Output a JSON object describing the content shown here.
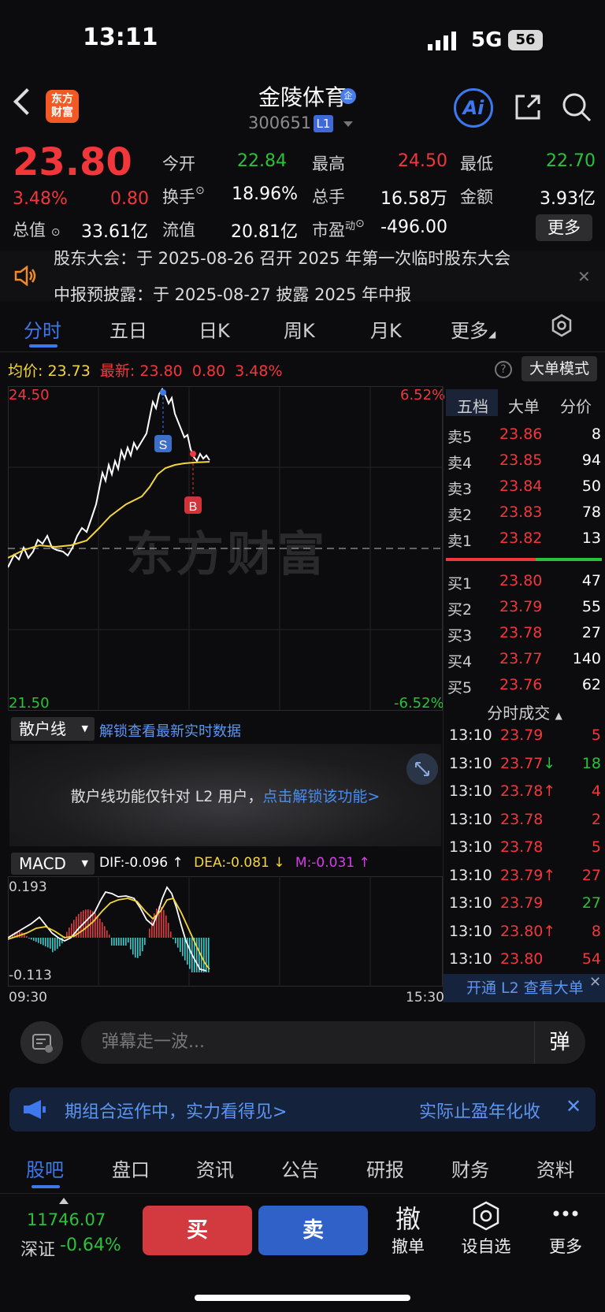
{
  "status_bar": {
    "time": "13:11",
    "network": "5G",
    "battery": "56"
  },
  "header": {
    "logo_text": "东方\n财富",
    "stock_name": "金陵体育",
    "name_badge": "企",
    "stock_code": "300651",
    "level": "L1",
    "ai_label": "Ai"
  },
  "quote": {
    "price": "23.80",
    "change_pct": "3.48%",
    "change_val": "0.80",
    "open_label": "今开",
    "open": "22.84",
    "high_label": "最高",
    "high": "24.50",
    "low_label": "最低",
    "low": "22.70",
    "turnover_label": "换手",
    "turnover": "18.96%",
    "volume_label": "总手",
    "volume": "16.58万",
    "amount_label": "金额",
    "amount": "3.93亿",
    "total_cap_label": "总值",
    "total_cap": "33.61亿",
    "float_cap_label": "流值",
    "float_cap": "20.81亿",
    "pe_label": "市盈",
    "pe_sup": "动",
    "pe": "-496.00",
    "more_label": "更多"
  },
  "notice": {
    "line1": "股东大会：于 2025-08-26 召开 2025 年第一次临时股东大会",
    "line2": "中报预披露：于 2025-08-27 披露 2025 年中报"
  },
  "chart_tabs": [
    "分时",
    "五日",
    "日K",
    "周K",
    "月K",
    "更多"
  ],
  "info_line": {
    "avg_label": "均价:",
    "avg": "23.73",
    "latest_label": "最新:",
    "latest": "23.80",
    "change": "0.80",
    "pct": "3.48%",
    "mode_button": "大单模式"
  },
  "chart_labels": {
    "y_top": "24.50",
    "y_bottom": "21.50",
    "pct_top": "6.52%",
    "pct_bottom": "-6.52%",
    "watermark": "东方财富",
    "sell_marker": "S",
    "buy_marker": "B"
  },
  "colors": {
    "up": "#f2373c",
    "down": "#29c23a",
    "avg": "#f4d63c",
    "accent": "#3d79ec"
  },
  "side_tabs": [
    "五档",
    "大单",
    "分价"
  ],
  "order_book": {
    "asks": [
      {
        "label": "卖5",
        "price": "23.86",
        "vol": "8"
      },
      {
        "label": "卖4",
        "price": "23.85",
        "vol": "94"
      },
      {
        "label": "卖3",
        "price": "23.84",
        "vol": "50"
      },
      {
        "label": "卖2",
        "price": "23.83",
        "vol": "78"
      },
      {
        "label": "卖1",
        "price": "23.82",
        "vol": "13"
      }
    ],
    "bids": [
      {
        "label": "买1",
        "price": "23.80",
        "vol": "47"
      },
      {
        "label": "买2",
        "price": "23.79",
        "vol": "55"
      },
      {
        "label": "买3",
        "price": "23.78",
        "vol": "27"
      },
      {
        "label": "买4",
        "price": "23.77",
        "vol": "140"
      },
      {
        "label": "买5",
        "price": "23.76",
        "vol": "62"
      }
    ]
  },
  "ticks": {
    "title": "分时成交",
    "rows": [
      {
        "time": "13:10",
        "price": "23.79",
        "arrow": "",
        "vol": "5",
        "dir": "up"
      },
      {
        "time": "13:10",
        "price": "23.77",
        "arrow": "↓",
        "vol": "18",
        "dir": "down"
      },
      {
        "time": "13:10",
        "price": "23.78",
        "arrow": "↑",
        "vol": "4",
        "dir": "up"
      },
      {
        "time": "13:10",
        "price": "23.78",
        "arrow": "",
        "vol": "2",
        "dir": "up"
      },
      {
        "time": "13:10",
        "price": "23.78",
        "arrow": "",
        "vol": "5",
        "dir": "up"
      },
      {
        "time": "13:10",
        "price": "23.79",
        "arrow": "↑",
        "vol": "27",
        "dir": "up"
      },
      {
        "time": "13:10",
        "price": "23.79",
        "arrow": "",
        "vol": "27",
        "dir": "down"
      },
      {
        "time": "13:10",
        "price": "23.80",
        "arrow": "↑",
        "vol": "8",
        "dir": "up"
      },
      {
        "time": "13:10",
        "price": "23.80",
        "arrow": "",
        "vol": "54",
        "dir": "up"
      }
    ],
    "l2_banner": "开通 L2 查看大单"
  },
  "retail": {
    "select": "散户线",
    "unlock": "解锁查看最新实时数据",
    "msg_prefix": "散户线功能仅针对 L2 用户，",
    "msg_link": "点击解锁该功能>"
  },
  "macd": {
    "select": "MACD",
    "dif": "DIF:-0.096 ↑",
    "dea": "DEA:-0.081 ↓",
    "m": "M:-0.031 ↑",
    "top": "0.193",
    "bottom": "-0.113",
    "time_start": "09:30",
    "time_end": "15:30"
  },
  "danmu": {
    "placeholder": "弹幕走一波...",
    "button": "弹"
  },
  "promo": {
    "text": "期组合运作中，实力看得见>",
    "text2": "实际止盈年化收"
  },
  "bottom_tabs": [
    "股吧",
    "盘口",
    "资讯",
    "公告",
    "研报",
    "财务",
    "资料"
  ],
  "action_bar": {
    "index_value": "11746.07",
    "index_name": "深证",
    "index_pct": "-0.64%",
    "buy": "买",
    "sell": "卖",
    "cancel_icon": "撤",
    "cancel": "撤单",
    "watch": "设自选",
    "more": "更多"
  }
}
